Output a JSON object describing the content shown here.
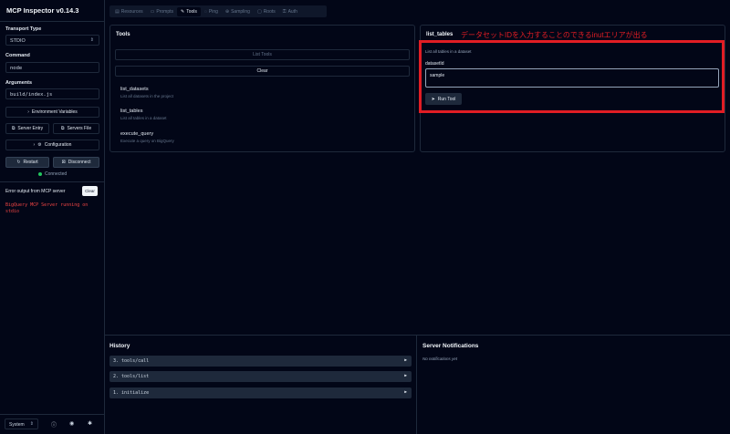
{
  "app": {
    "title": "MCP Inspector v0.14.3"
  },
  "sidebar": {
    "transport_label": "Transport Type",
    "transport_value": "STDIO",
    "command_label": "Command",
    "command_value": "node",
    "arguments_label": "Arguments",
    "arguments_value": "build/index.js",
    "env_button": "Environment Variables",
    "server_entry_button": "Server Entry",
    "servers_file_button": "Servers File",
    "configuration_button": "Configuration",
    "restart_button": "Restart",
    "disconnect_button": "Disconnect",
    "status_text": "Connected",
    "error_title": "Error output from MCP server",
    "error_clear": "Clear",
    "error_text": "BigQuery MCP Server running on stdio",
    "theme_value": "System"
  },
  "tabs": [
    {
      "label": "Resources",
      "icon": "resources-icon"
    },
    {
      "label": "Prompts",
      "icon": "prompts-icon"
    },
    {
      "label": "Tools",
      "icon": "wrench-icon"
    },
    {
      "label": "Ping",
      "icon": "ping-icon"
    },
    {
      "label": "Sampling",
      "icon": "sampling-icon"
    },
    {
      "label": "Roots",
      "icon": "roots-icon"
    },
    {
      "label": "Auth",
      "icon": "auth-icon"
    }
  ],
  "active_tab": "Tools",
  "tools_panel": {
    "title": "Tools",
    "list_button": "List Tools",
    "clear_button": "Clear",
    "items": [
      {
        "name": "list_datasets",
        "description": "List all datasets in the project"
      },
      {
        "name": "list_tables",
        "description": "List all tables in a dataset"
      },
      {
        "name": "execute_query",
        "description": "Execute a query on BigQuery"
      }
    ]
  },
  "detail_panel": {
    "title": "list_tables",
    "subtitle": "List all tables in a dataset",
    "field_label": "datasetId",
    "field_value": "sample",
    "run_button": "Run Tool"
  },
  "annotation": {
    "text": "データセットIDを入力することのできるinutエリアが出る",
    "color": "#e11d24"
  },
  "history": {
    "title": "History",
    "items": [
      "3. tools/call",
      "2. tools/list",
      "1. initialize"
    ]
  },
  "notifications": {
    "title": "Server Notifications",
    "empty_text": "No notifications yet"
  }
}
